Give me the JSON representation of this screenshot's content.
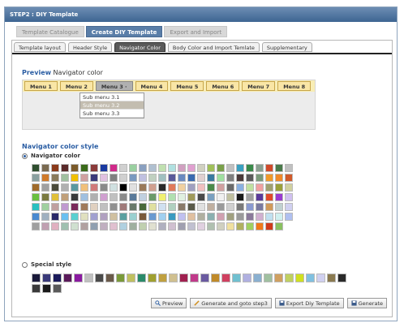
{
  "window": {
    "title": "STEP2 : DIY Template"
  },
  "top_tabs": [
    {
      "label": "Template Catalogue",
      "state": "dim"
    },
    {
      "label": "Create DIY Template",
      "state": "active"
    },
    {
      "label": "Export and Import",
      "state": "dim"
    }
  ],
  "sub_tabs": [
    {
      "label": "Template layout",
      "active": false
    },
    {
      "label": "Header Style",
      "active": false
    },
    {
      "label": "Navigator Color",
      "active": true
    },
    {
      "label": "Body Color and Import Temlate",
      "active": false
    },
    {
      "label": "Supplementary",
      "active": false
    }
  ],
  "preview": {
    "title_prefix": "Preview",
    "title_suffix": " Navigator color",
    "menus": [
      "Menu 1",
      "Menu 2",
      "Menu 3 ·",
      "Menu 4",
      "Menu 5",
      "Menu 6",
      "Menu 7",
      "Menu 8"
    ],
    "submenu": [
      "Sub menu 3.1",
      "Sub menu 3.2",
      "Sub menu 3.3"
    ],
    "submenu_highlight_index": 1
  },
  "navigator_style": {
    "title": "Navigator color style",
    "option_navigator": "Navigator color",
    "option_special": "Special style"
  },
  "colors_navigator": [
    "#2f4f2f",
    "#7a6a50",
    "#8a3a1a",
    "#5a2a2a",
    "#7a5a2a",
    "#3a6a1a",
    "#8a3a3a",
    "#1a3aa0",
    "#d02a8a",
    "#d0d0d0",
    "#9ad0a0",
    "#8aa0c0",
    "#b0c0d0",
    "#c0e0b0",
    "#b0e0e0",
    "#d0a0c0",
    "#e0a0d0",
    "#d0d0c0",
    "#a0c05a",
    "#7aa04a",
    "#c0c0c0",
    "#3aa0c0",
    "#3a8a4a",
    "#8aa090",
    "#d04a2a",
    "#4a7a4a",
    "#c0c0c0",
    "#8aa0a0",
    "#d07a2a",
    "#8a7a5a",
    "#a0c0a0",
    "#f0c000",
    "#d0a0a0",
    "#3a3a7a",
    "#e0c0e0",
    "#808080",
    "#d0d0d0",
    "#7a9ac0",
    "#c0c0e0",
    "#c0d0c0",
    "#a0c0c0",
    "#5a5a9a",
    "#6a8ac0",
    "#3a6ab0",
    "#e0d0d0",
    "#3a7aa0",
    "#a0e0a0",
    "#808080",
    "#4a3a3a",
    "#5a5a5a",
    "#7a9a7a",
    "#f09a2a",
    "#f08a2a",
    "#d05a2a",
    "#a06a2a",
    "#a0a0a0",
    "#4a4a3a",
    "#b0b0b0",
    "#5a9aa0",
    "#f0c07a",
    "#d07a7a",
    "#8a8a8a",
    "#d0e0e0",
    "#000000",
    "#e0e0e0",
    "#9a7a5a",
    "#d0a090",
    "#2a2a2a",
    "#e07a5a",
    "#f0d0a0",
    "#a0a0c0",
    "#f0c0c0",
    "#4a8a4a",
    "#d0a0a0",
    "#6a6a6a",
    "#8ab0e0",
    "#c0e0a0",
    "#f0a0a0",
    "#a0a070",
    "#9aa03a",
    "#d0d0a0",
    "#6ac040",
    "#7a7a40",
    "#e0c03a",
    "#c0a07a",
    "#3a3a3a",
    "#a0c0e0",
    "#b0b0b0",
    "#d0a0d0",
    "#c0c0c0",
    "#8a8a8a",
    "#5a7a9a",
    "#c0d0e0",
    "#6a9a6a",
    "#f0f070",
    "#b0e0b0",
    "#e0f0e0",
    "#a09a5a",
    "#4a4a4a",
    "#7aa0c0",
    "#f0f0f0",
    "#c0c0a0",
    "#1a1a1a",
    "#a0a0a0",
    "#5a3a9a",
    "#e04a2a",
    "#9a3ad0",
    "#d0c0f0",
    "#2ac0c0",
    "#a0d0a0",
    "#c0a0a0",
    "#c09ad0",
    "#7a2a5a",
    "#a07a5a",
    "#e0d0c0",
    "#c0c0c0",
    "#909090",
    "#a07a7a",
    "#6a7a6a",
    "#4a6a3a",
    "#e0e0a0",
    "#d0e0f0",
    "#b0d0c0",
    "#8a7a6a",
    "#5a5a4a",
    "#e0e0e0",
    "#c0b0a0",
    "#9a9a9a",
    "#d0d0d0",
    "#7a7a7a",
    "#8a9ad0",
    "#7a7aa0",
    "#d09a5a",
    "#c0d0d0",
    "#d0d0f0",
    "#4a8ad0",
    "#a0b0c0",
    "#2a2a6a",
    "#6ac0f0",
    "#5ad0d0",
    "#e0e0c0",
    "#a0a0d0",
    "#b0a0c0",
    "#d0c0a0",
    "#5aa0a0",
    "#9ad0d0",
    "#7a5a3a",
    "#6a9ad0",
    "#a0d0f0",
    "#3a9ac0",
    "#c0c0f0",
    "#e0c0a0",
    "#b0b0a0",
    "#8ab0b0",
    "#d0a0b0",
    "#a0a080",
    "#9a9a9a",
    "#8a7a9a",
    "#d0b0d0",
    "#c0e0f0",
    "#d0f0f0",
    "#b0c0f0",
    "#a0a0a0",
    "#c0a0b0",
    "#e0b0c0",
    "#a0c0b0",
    "#d0e0d0",
    "#b0a0a0",
    "#90a0b0",
    "#c0b0c0",
    "#e0c0d0",
    "#b0d0e0",
    "#a0b0a0",
    "#c0d0b0",
    "#e0e0d0",
    "#b0b0c0",
    "#d0c0d0",
    "#a0a0b0",
    "#c0c0d0",
    "#e0d0e0",
    "#b0c0b0",
    "#d0d0c0",
    "#f0e0a0",
    "#b0b060",
    "#a0d060",
    "#f07a1a",
    "#d03a1a",
    "#8ac060"
  ],
  "colors_special": [
    "#1a1a3a",
    "#3a3a7a",
    "#1a1a5a",
    "#5a1a5a",
    "#8a1aa0",
    "#c0c0c0",
    "#4a4a4a",
    "#6a5a4a",
    "#7a9a3a",
    "#c0c060",
    "#2a8a6a",
    "#a0a030",
    "#c0a040",
    "#d0c090",
    "#a02050",
    "#c03a8a",
    "#6a5aa0",
    "#c08a2a",
    "#d04060",
    "#70c0d0",
    "#b0b0e0",
    "#8ab0d0",
    "#a0c0a0",
    "#d0a060",
    "#c0d060",
    "#d0e020",
    "#80c0e0",
    "#d0d0f0",
    "#8a7a50",
    "#2a2a2a",
    "#3a3a3a",
    "#1a1a1a",
    "#5a5a5a"
  ],
  "buttons": {
    "preview": "Preview",
    "generate_step3": "Generate and goto step3",
    "export": "Export Diy Template",
    "generate": "Generate"
  }
}
